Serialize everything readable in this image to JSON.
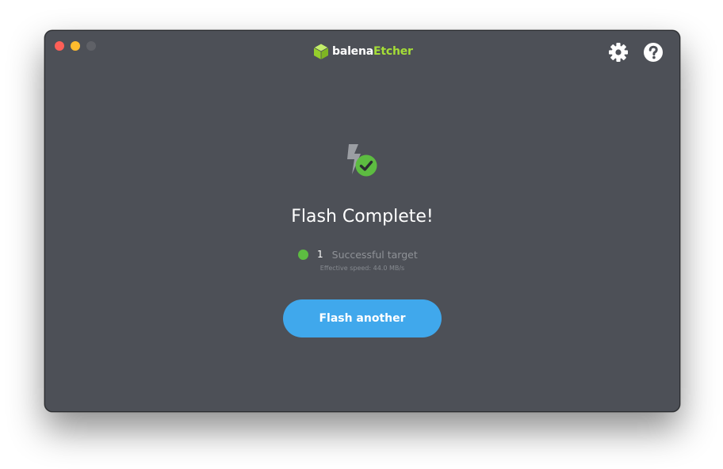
{
  "app": {
    "brand_prefix": "balena",
    "brand_suffix": "Etcher"
  },
  "toolbar": {
    "settings_icon": "gear-icon",
    "help_icon": "question-mark-icon"
  },
  "status": {
    "title": "Flash Complete!",
    "success_count": "1",
    "success_label": "Successful target",
    "speed_text": "Effective speed: 44.0 MB/s",
    "icon": "flash-success-icon"
  },
  "actions": {
    "flash_another_label": "Flash another"
  },
  "colors": {
    "window_bg": "#4d5057",
    "accent_green": "#a5de37",
    "success_green": "#5dbc41",
    "button_blue": "#40a8ec"
  }
}
